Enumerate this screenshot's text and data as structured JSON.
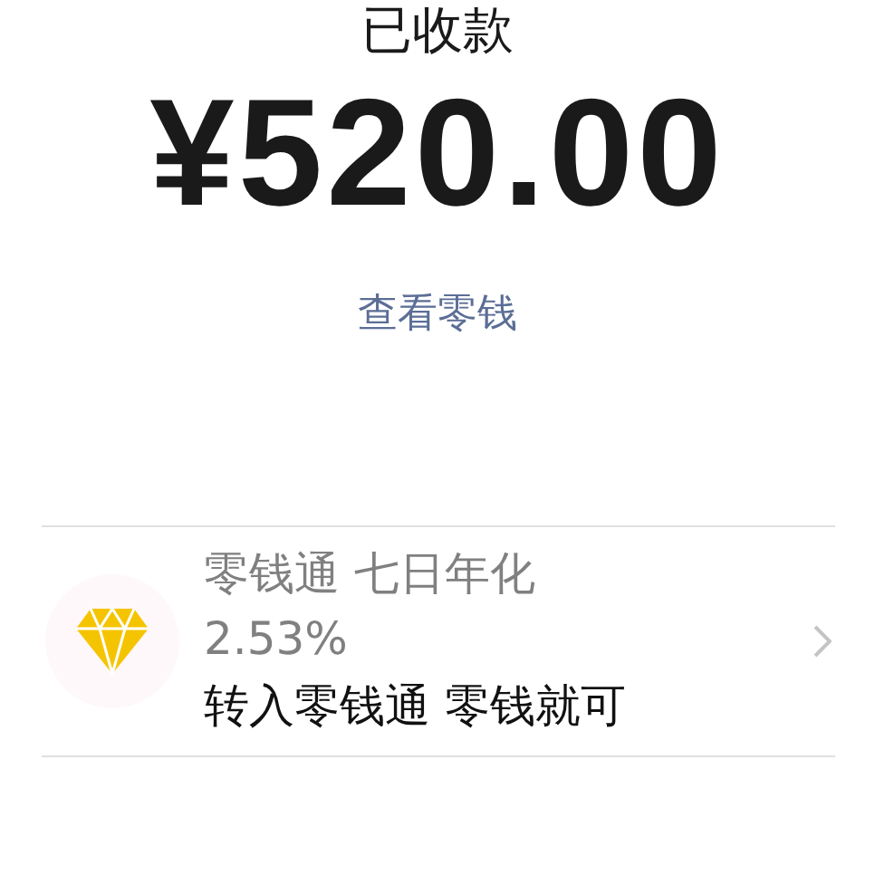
{
  "status": {
    "title": "已收款",
    "amount": "¥520.00",
    "link": "查看零钱"
  },
  "promo": {
    "title": "零钱通 七日年化",
    "rate": "2.53%",
    "action": "转入零钱通 零钱就可"
  }
}
